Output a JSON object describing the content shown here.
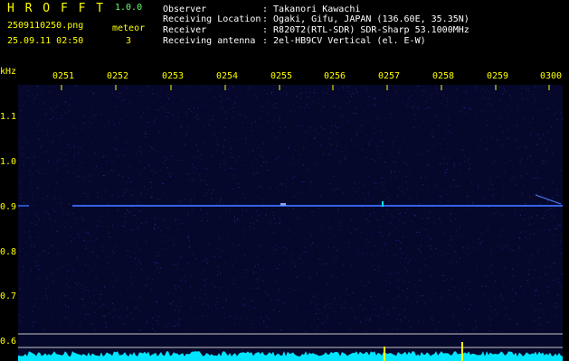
{
  "header": {
    "app_title": "H R O F F T",
    "version": "1.0.0",
    "filename": "2509110250.png",
    "meteor_label": "meteor",
    "meteor_count": "3",
    "datetime": "25.09.11 02:50",
    "fields": [
      {
        "label": "Observer",
        "value": ": Takanori Kawachi"
      },
      {
        "label": "Receiving Location",
        "value": ": Ogaki, Gifu, JAPAN (136.60E, 35.35N)"
      },
      {
        "label": "Receiver",
        "value": ": R820T2(RTL-SDR) SDR-Sharp 53.1000MHz"
      },
      {
        "label": "Receiving antenna",
        "value": ": 2el-HB9CV Vertical (el. E-W)"
      }
    ]
  },
  "axes": {
    "y_unit": "kHz",
    "y_ticks": [
      "1.1",
      "1.0",
      "0.9",
      "0.8",
      "0.7",
      "0.6"
    ],
    "x_ticks": [
      "0251",
      "0252",
      "0253",
      "0254",
      "0255",
      "0256",
      "0257",
      "0258",
      "0259",
      "0300"
    ]
  },
  "colors": {
    "background": "#000000",
    "label_yellow": "#ffff00",
    "header_white": "#ffffff",
    "version_green": "#66ff66",
    "plot_bg": "#05082a",
    "trace_blue": "#3a6cff",
    "signal_cyan": "#00e5ff"
  }
}
